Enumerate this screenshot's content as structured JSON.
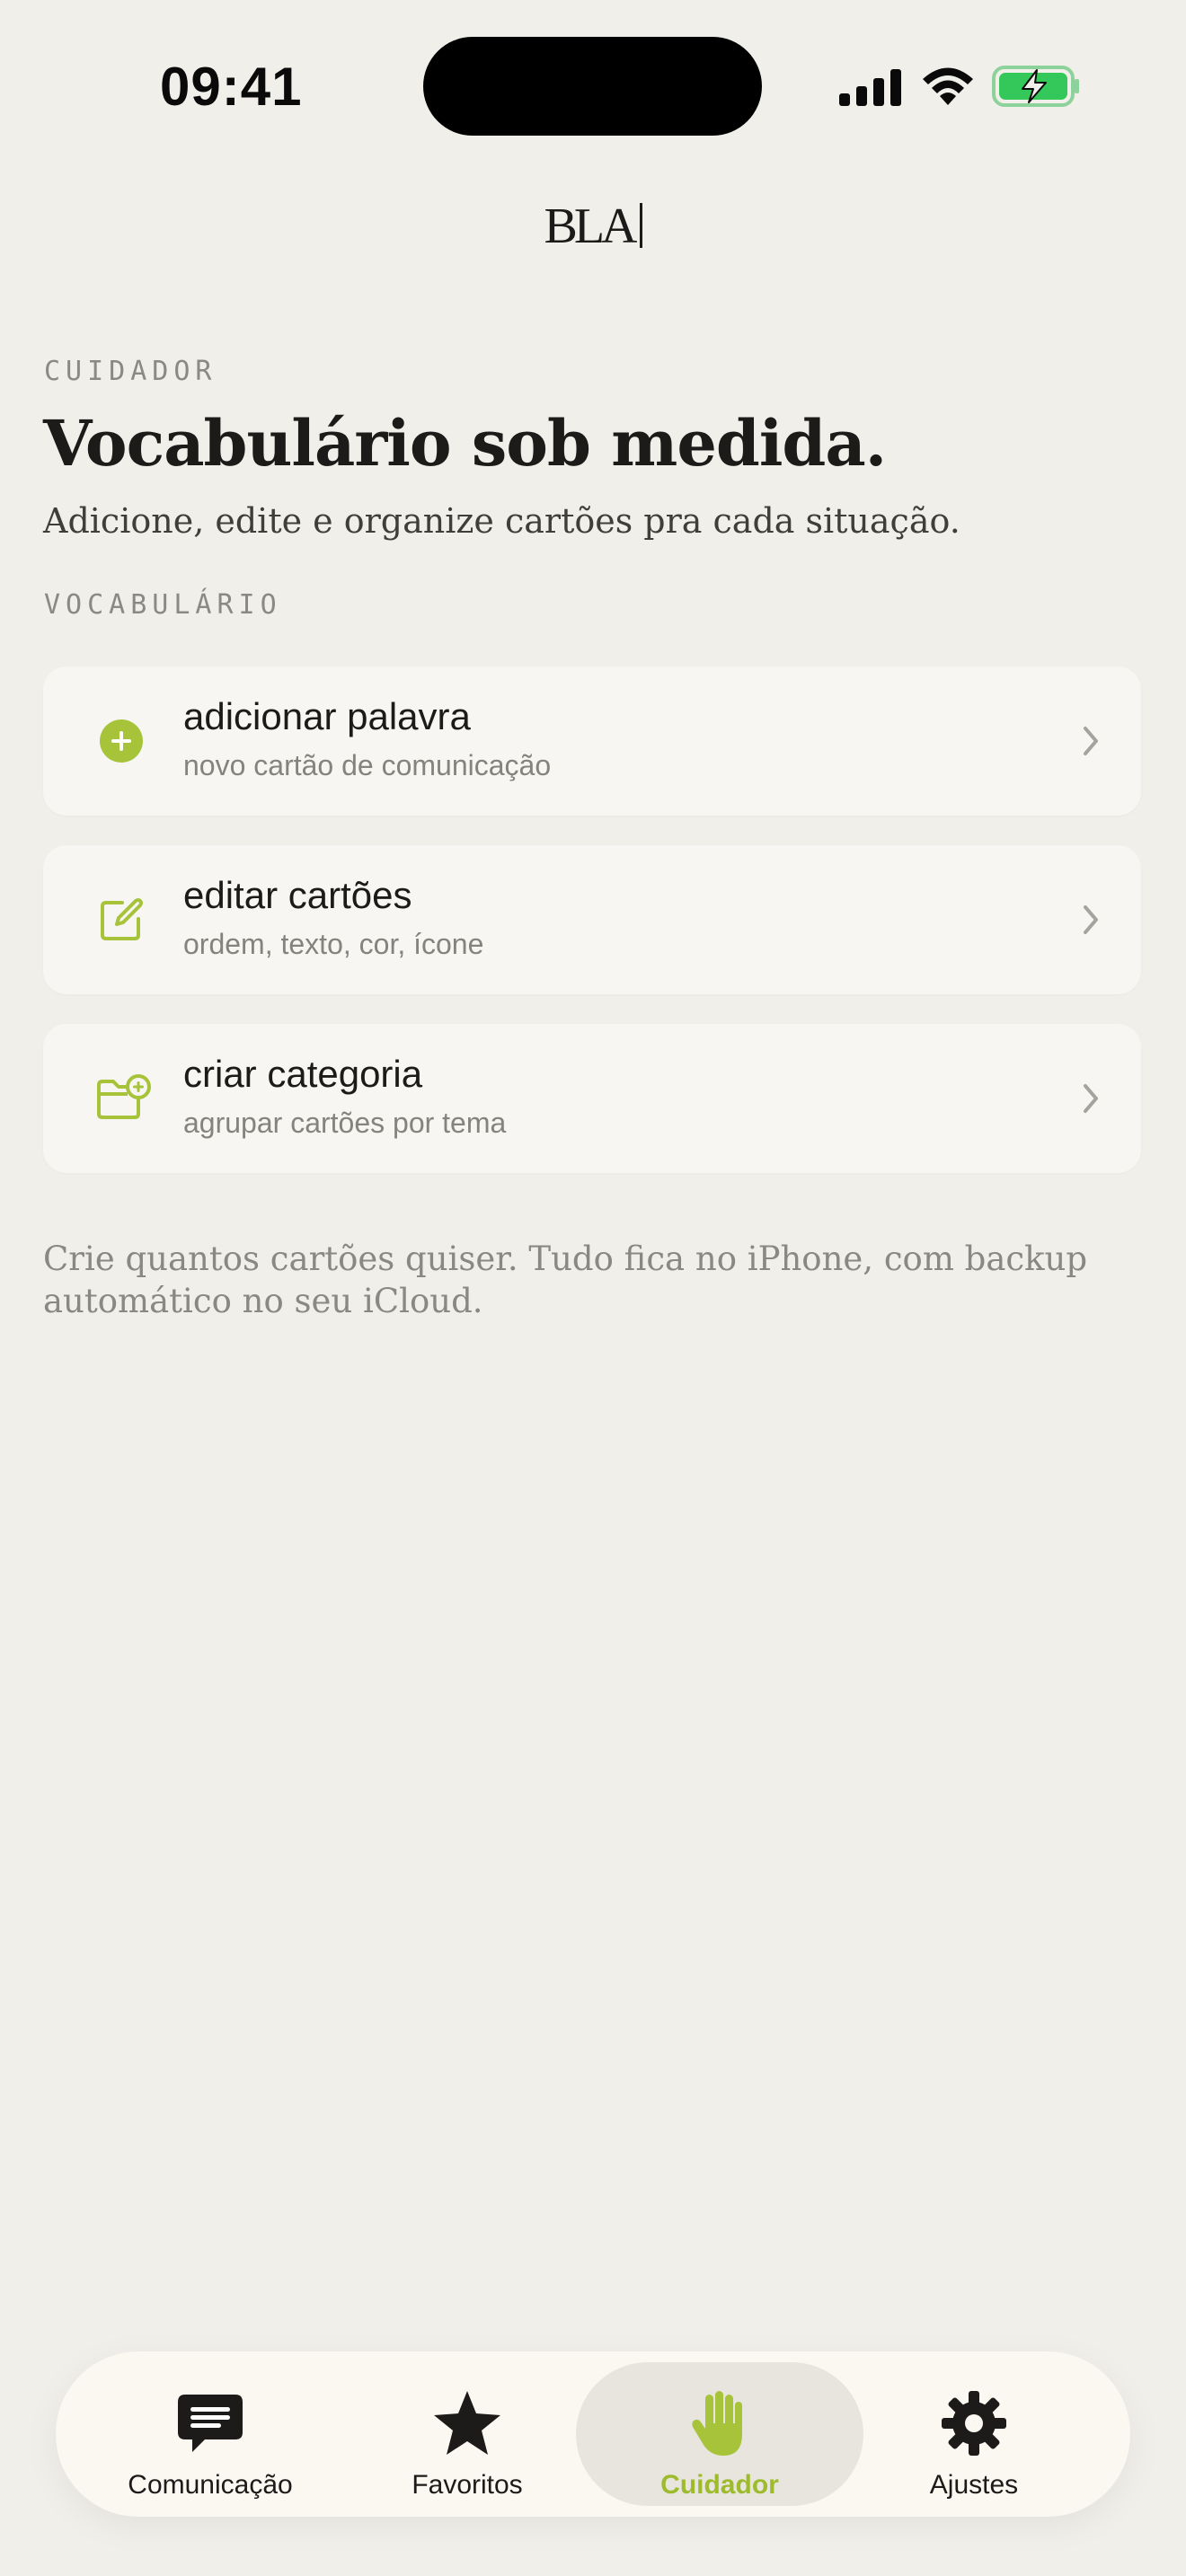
{
  "status_bar": {
    "time": "09:41",
    "icons": [
      "signal-icon",
      "wifi-icon",
      "battery-charging-icon"
    ]
  },
  "app": {
    "logo_text": "BLA"
  },
  "header": {
    "eyebrow": "CUIDADOR",
    "title": "Vocabulário sob medida.",
    "subtitle": "Adicione, edite e organize cartões pra cada situação."
  },
  "section": {
    "label": "VOCABULÁRIO",
    "items": [
      {
        "title": "adicionar palavra",
        "subtitle": "novo cartão de comunicação",
        "icon": "plus-circle-icon"
      },
      {
        "title": "editar cartões",
        "subtitle": "ordem, texto, cor, ícone",
        "icon": "edit-square-icon"
      },
      {
        "title": "criar categoria",
        "subtitle": "agrupar cartões por tema",
        "icon": "folder-add-icon"
      }
    ]
  },
  "footnote": "Crie quantos cartões quiser. Tudo fica no iPhone, com backup automático no seu iCloud.",
  "tabbar": {
    "tabs": [
      {
        "label": "Comunicação",
        "icon": "chat-bubble-icon",
        "active": false
      },
      {
        "label": "Favoritos",
        "icon": "star-icon",
        "active": false
      },
      {
        "label": "Cuidador",
        "icon": "hand-icon",
        "active": true
      },
      {
        "label": "Ajustes",
        "icon": "gear-icon",
        "active": false
      }
    ]
  },
  "colors": {
    "accent": "#a6c33a",
    "background": "#f1efea",
    "card": "#f7f6f2",
    "battery": "#34c759"
  }
}
